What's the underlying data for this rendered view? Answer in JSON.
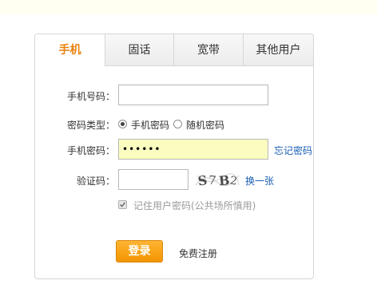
{
  "tabs": [
    {
      "label": "手机",
      "active": true
    },
    {
      "label": "固话",
      "active": false
    },
    {
      "label": "宽带",
      "active": false
    },
    {
      "label": "其他用户",
      "active": false
    }
  ],
  "form": {
    "phone_label": "手机号码：",
    "phone_value": "",
    "type_label": "密码类型：",
    "type_options": [
      {
        "label": "手机密码",
        "checked": true
      },
      {
        "label": "随机密码",
        "checked": false
      }
    ],
    "password_label": "手机密码：",
    "password_value": "••••••",
    "forgot_link": "忘记密码",
    "captcha_label": "验证码：",
    "captcha_value": "",
    "captcha_image_text": "S7B2",
    "refresh_link": "换一张",
    "remember_label": "记住用户密码(公共场所慎用)",
    "remember_checked": true,
    "login_button": "登录",
    "register_link": "免费注册"
  },
  "colors": {
    "accent": "#e8800a",
    "button": "#f29500",
    "link": "#1a5fb4",
    "highlight_input": "#fbfdc0"
  }
}
